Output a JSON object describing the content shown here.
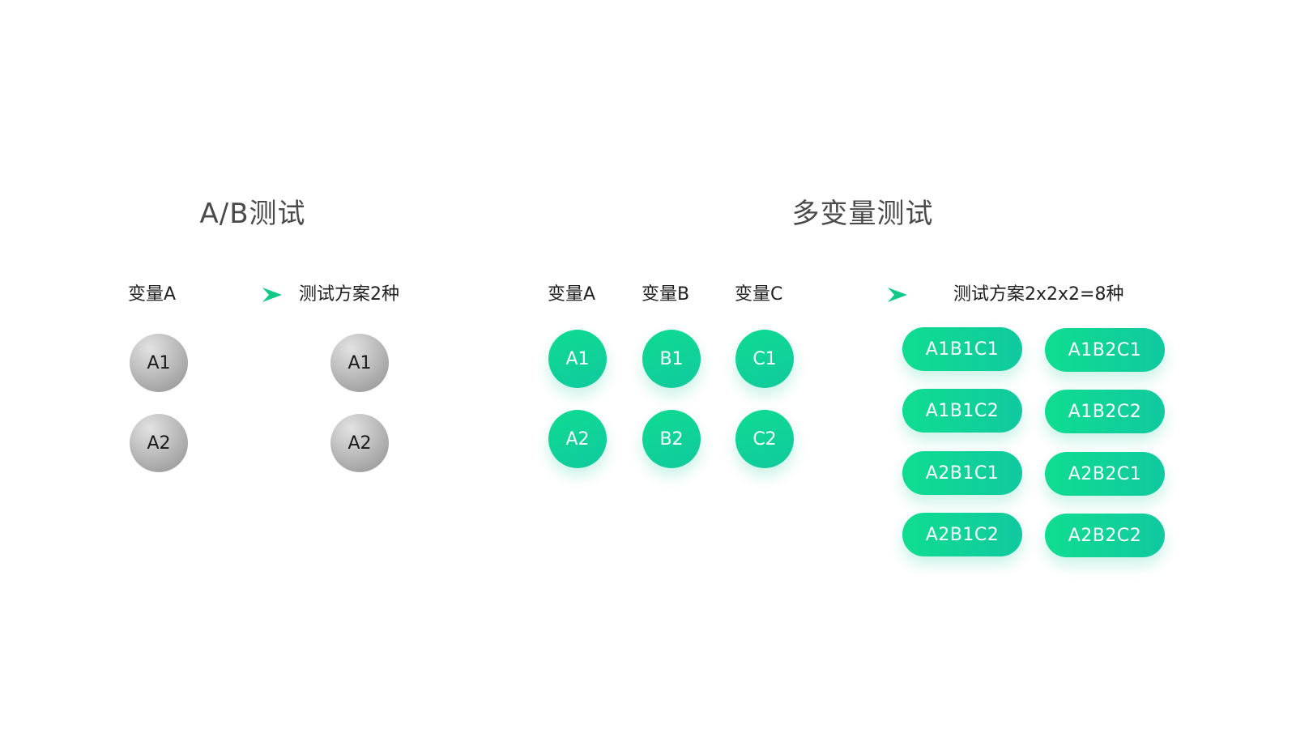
{
  "ab": {
    "title": "A/B测试",
    "variable_label": "变量A",
    "result_label": "测试方案2种",
    "variable_values": [
      "A1",
      "A2"
    ],
    "result_values": [
      "A1",
      "A2"
    ]
  },
  "multi": {
    "title": "多变量测试",
    "variables": [
      {
        "label": "变量A",
        "values": [
          "A1",
          "A2"
        ]
      },
      {
        "label": "变量B",
        "values": [
          "B1",
          "B2"
        ]
      },
      {
        "label": "变量C",
        "values": [
          "C1",
          "C2"
        ]
      }
    ],
    "result_label": "测试方案2x2x2=8种",
    "combinations": [
      [
        "A1B1C1",
        "A1B2C1"
      ],
      [
        "A1B1C2",
        "A1B2C2"
      ],
      [
        "A2B1C1",
        "A2B2C1"
      ],
      [
        "A2B1C2",
        "A2B2C2"
      ]
    ]
  },
  "colors": {
    "arrow": "#12c98a",
    "green_start": "#0fdb93",
    "green_end": "#10ca9e",
    "gray": "#bdbdbd"
  }
}
